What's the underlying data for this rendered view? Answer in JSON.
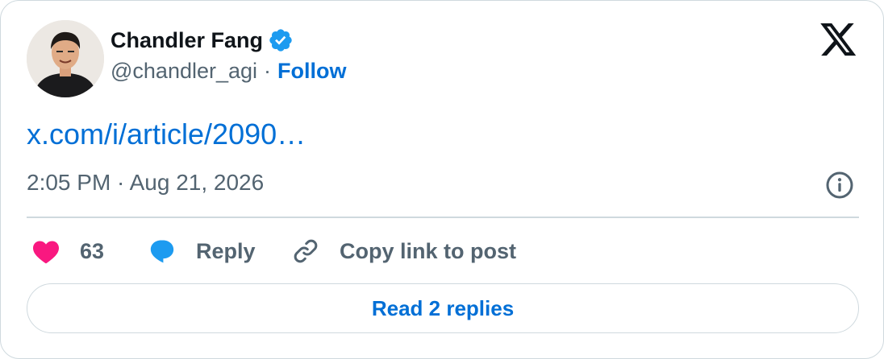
{
  "author": {
    "name": "Chandler Fang",
    "handle": "@chandler_agi",
    "separator": "·",
    "follow_label": "Follow",
    "verified": true
  },
  "brand_icon": "x-logo-icon",
  "post": {
    "link_text": "x.com/i/article/2090…",
    "timestamp": "2:05 PM · Aug 21, 2026"
  },
  "actions": {
    "like_count": "63",
    "reply_label": "Reply",
    "copy_label": "Copy link to post"
  },
  "read_replies_label": "Read 2 replies",
  "colors": {
    "link_blue": "#006fd6",
    "like_pink": "#f91880",
    "reply_blue": "#1d9bf0",
    "verified_blue": "#1d9bf0",
    "muted_text": "#536471",
    "border": "#cfd9de"
  }
}
